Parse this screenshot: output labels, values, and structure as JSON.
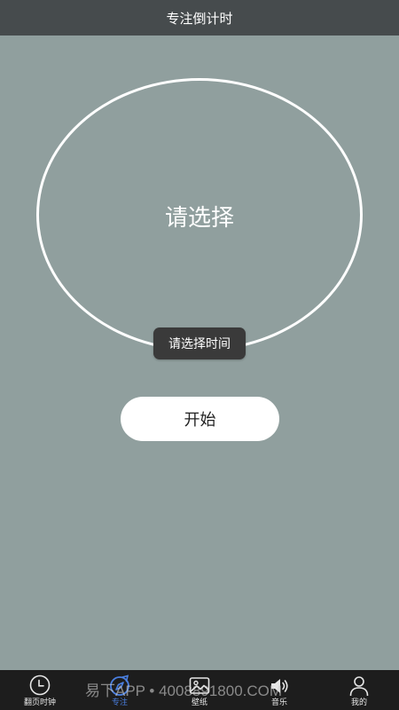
{
  "header": {
    "title": "专注倒计时"
  },
  "timer": {
    "display": "请选择"
  },
  "toast": {
    "message": "请选择时间"
  },
  "actions": {
    "start_label": "开始"
  },
  "tabbar": {
    "items": [
      {
        "label": "翻页时钟",
        "icon": "clock-icon",
        "active": false
      },
      {
        "label": "专注",
        "icon": "compass-icon",
        "active": true
      },
      {
        "label": "壁纸",
        "icon": "image-icon",
        "active": false
      },
      {
        "label": "音乐",
        "icon": "speaker-icon",
        "active": false
      },
      {
        "label": "我的",
        "icon": "person-icon",
        "active": false
      }
    ]
  },
  "watermark": {
    "text": "易下APP • 4008891800.COM"
  },
  "colors": {
    "background": "#909f9e",
    "title_bar": "#464b4d",
    "tab_bar": "#1d1d1d",
    "active_tab": "#4a7fe0",
    "toast_bg": "#3a3a3a"
  }
}
